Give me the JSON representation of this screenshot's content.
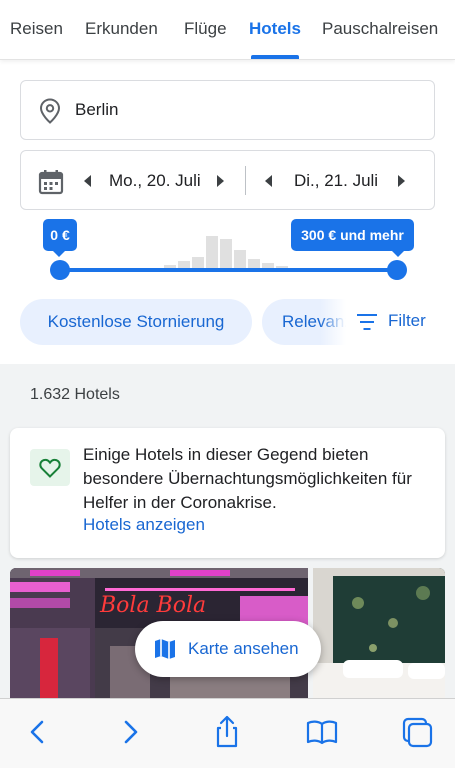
{
  "tabs": [
    {
      "label": "Reisen",
      "active": false
    },
    {
      "label": "Erkunden",
      "active": false
    },
    {
      "label": "Flüge",
      "active": false
    },
    {
      "label": "Hotels",
      "active": true
    },
    {
      "label": "Pauschalreisen",
      "active": false
    }
  ],
  "search": {
    "location": "Berlin",
    "checkin": "Mo., 20. Juli",
    "checkout": "Di., 21. Juli"
  },
  "price": {
    "min_label": "0 €",
    "max_label": "300 € und mehr",
    "histogram": [
      0.05,
      0.15,
      0.25,
      0.35,
      0.95,
      0.85,
      0.55,
      0.3,
      0.2,
      0.1,
      0.05
    ]
  },
  "chips": {
    "free_cancel": "Kostenlose Stornierung",
    "sort": "Relevanz",
    "filter": "Filter"
  },
  "results": {
    "count": "1.632 Hotels"
  },
  "notice": {
    "text": "Einige Hotels in dieser Gegend bieten besondere Übernachtungsmöglichkeiten für Helfer in der Coronakrise.",
    "link": "Hotels anzeigen"
  },
  "map_button": "Karte ansehen",
  "colors": {
    "accent": "#1a73e8",
    "chip_bg": "#e8f0fe",
    "heart": "#188038"
  }
}
